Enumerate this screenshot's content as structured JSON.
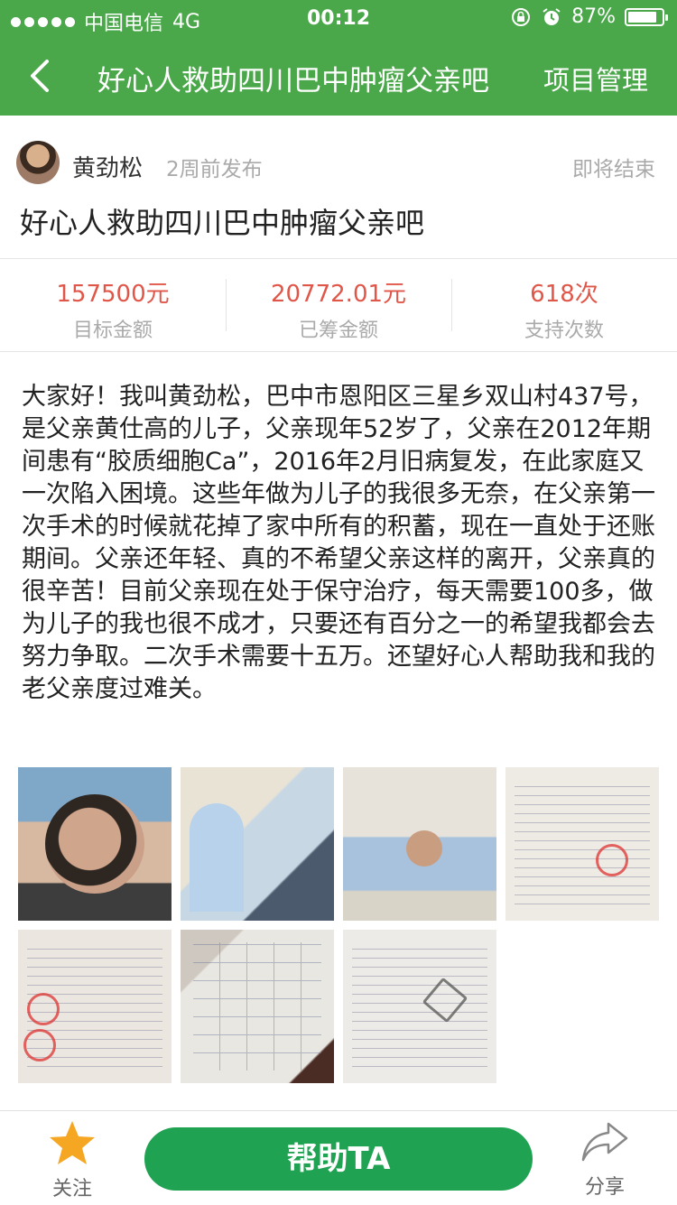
{
  "status_bar": {
    "carrier": "中国电信",
    "network": "4G",
    "time": "00:12",
    "battery": "87%",
    "battery_level": 0.87
  },
  "nav": {
    "title": "好心人救助四川巴中肿瘤父亲吧",
    "action": "项目管理"
  },
  "author": {
    "name": "黄劲松",
    "posted": "2周前发布",
    "status": "即将结束"
  },
  "project_title": "好心人救助四川巴中肿瘤父亲吧",
  "stats": [
    {
      "value": "157500元",
      "label": "目标金额"
    },
    {
      "value": "20772.01元",
      "label": "已筹金额"
    },
    {
      "value": "618次",
      "label": "支持次数"
    }
  ],
  "description": "大家好！我叫黄劲松，巴中市恩阳区三星乡双山村437号，是父亲黄仕高的儿子，父亲现年52岁了，父亲在2012年期间患有“胶质细胞Ca”，2016年2月旧病复发，在此家庭又一次陷入困境。这些年做为儿子的我很多无奈，在父亲第一次手术的时候就花掉了家中所有的积蓄，现在一直处于还账期间。父亲还年轻、真的不希望父亲这样的离开，父亲真的很辛苦！目前父亲现在处于保守治疗，每天需要100多，做为儿子的我也很不成才，只要还有百分之一的希望我都会去努力争取。二次手术需要十五万。还望好心人帮助我和我的老父亲度过难关。",
  "bottom": {
    "follow_label": "关注",
    "help_label": "帮助TA",
    "share_label": "分享"
  },
  "colors": {
    "brand_green": "#4aa84a",
    "button_green": "#1fa251",
    "stat_red": "#e0574a",
    "star_orange": "#f5a623"
  }
}
